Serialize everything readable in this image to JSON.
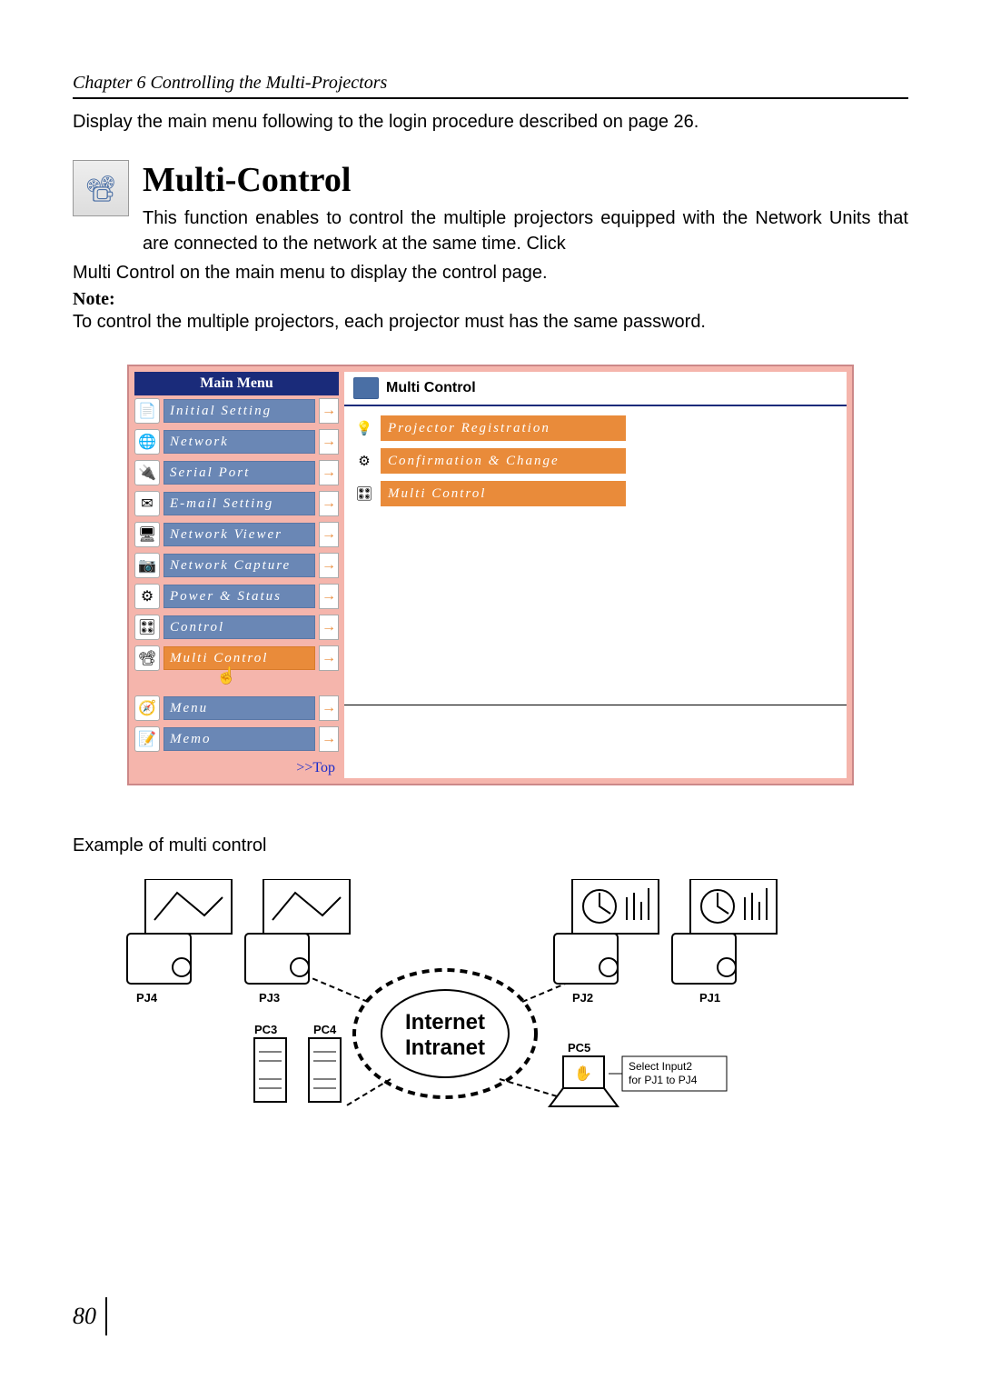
{
  "chapter_header": "Chapter 6 Controlling the Multi-Projectors",
  "intro_text": "Display the main menu following to the login procedure described on page 26.",
  "section": {
    "title": "Multi-Control",
    "body_first": "This function enables to control the multiple projectors equipped with the Network Units that are connected to the network at the same time. Click",
    "body_cont1": "Multi Control",
    "body_cont2": " on the main menu to display the control page.",
    "note_label": "Note:",
    "note_text": "To control the multiple projectors, each projector must has the same password."
  },
  "main_menu": {
    "title": "Main Menu",
    "items": [
      {
        "label": "Initial Setting",
        "icon": "📄",
        "highlight": false
      },
      {
        "label": "Network",
        "icon": "🌐",
        "highlight": false
      },
      {
        "label": "Serial Port",
        "icon": "🔌",
        "highlight": false
      },
      {
        "label": "E-mail Setting",
        "icon": "✉",
        "highlight": false
      },
      {
        "label": "Network Viewer",
        "icon": "🖥",
        "highlight": false
      },
      {
        "label": "Network Capture",
        "icon": "📷",
        "highlight": false
      },
      {
        "label": "Power & Status",
        "icon": "⚙",
        "highlight": false
      },
      {
        "label": "Control",
        "icon": "🎛",
        "highlight": false
      },
      {
        "label": "Multi Control",
        "icon": "📽",
        "highlight": true
      },
      {
        "label": "Menu",
        "icon": "🧭",
        "highlight": false
      },
      {
        "label": "Memo",
        "icon": "📝",
        "highlight": false
      }
    ],
    "top_link": ">>Top"
  },
  "right_panel": {
    "title": "Multi Control",
    "items": [
      {
        "label": "Projector Registration",
        "icon": "💡"
      },
      {
        "label": "Confirmation & Change",
        "icon": "⚙"
      },
      {
        "label": "Multi Control",
        "icon": "🎛"
      }
    ]
  },
  "example_caption": "Example of multi control",
  "diagram": {
    "center_line1": "Internet",
    "center_line2": "Intranet",
    "labels": {
      "pj1": "PJ1",
      "pj2": "PJ2",
      "pj3": "PJ3",
      "pj4": "PJ4",
      "pc3": "PC3",
      "pc4": "PC4",
      "pc5": "PC5"
    },
    "note_line1": "Select Input2",
    "note_line2": "for PJ1 to PJ4"
  },
  "page_number": "80"
}
